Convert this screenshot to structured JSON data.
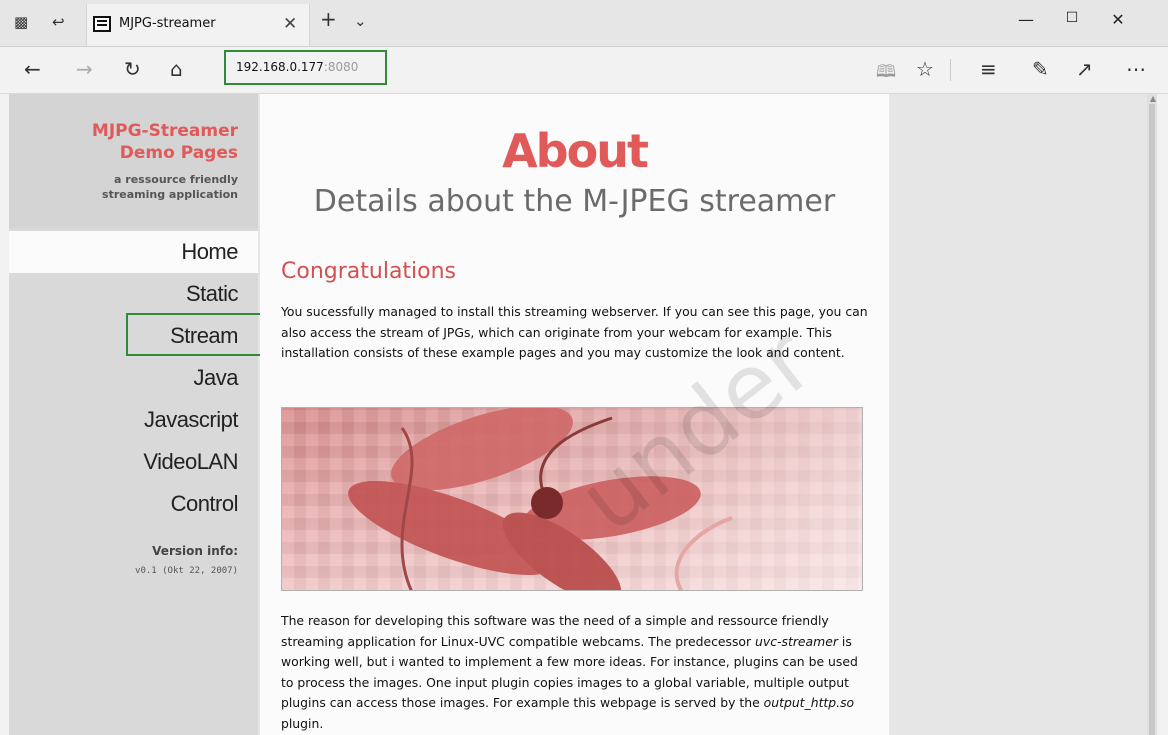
{
  "tab": {
    "title": "MJPG-streamer"
  },
  "address_bar": {
    "host": "192.168.0.177",
    "port": ":8080"
  },
  "sidebar": {
    "brand_title_line1": "MJPG-Streamer",
    "brand_title_line2": "Demo Pages",
    "brand_sub_line1": "a ressource friendly",
    "brand_sub_line2": "streaming application",
    "menu": [
      "Home",
      "Static",
      "Stream",
      "Java",
      "Javascript",
      "VideoLAN",
      "Control"
    ],
    "active_item": "Home",
    "version_label": "Version info:",
    "version_value": "v0.1 (Okt 22, 2007)"
  },
  "main": {
    "title": "About",
    "subtitle": "Details about the M-JPEG streamer",
    "section_title": "Congratulations",
    "para1": "You sucessfully managed to install this streaming webserver. If you can see this page, you can also access the stream of JPGs, which can originate from your webcam for example. This installation consists of these example pages and you may customize the look and content.",
    "para2_a": "The reason for developing this software was the need of a simple and ressource friendly streaming application for Linux-UVC compatible webcams. The predecessor ",
    "para2_em1": "uvc-streamer",
    "para2_b": " is working well, but i wanted to implement a few more ideas. For instance, plugins can be used to process the images. One input plugin copies images to a global variable, multiple output plugins can access those images. For example this webpage is served by the ",
    "para2_em2": "output_http.so",
    "para2_c": " plugin."
  },
  "watermark": "under",
  "colors": {
    "accent": "#e05a5a",
    "highlight_box": "#2f8a3a"
  },
  "icons": [
    "tab-actions-icon",
    "tabs-aside-icon",
    "new-tab-icon",
    "tab-list-icon",
    "back-icon",
    "forward-icon",
    "refresh-icon",
    "home-icon",
    "reading-view-icon",
    "favorite-star-icon",
    "hub-icon",
    "notes-icon",
    "share-icon",
    "more-icon",
    "minimize-icon",
    "maximize-icon",
    "close-icon"
  ]
}
